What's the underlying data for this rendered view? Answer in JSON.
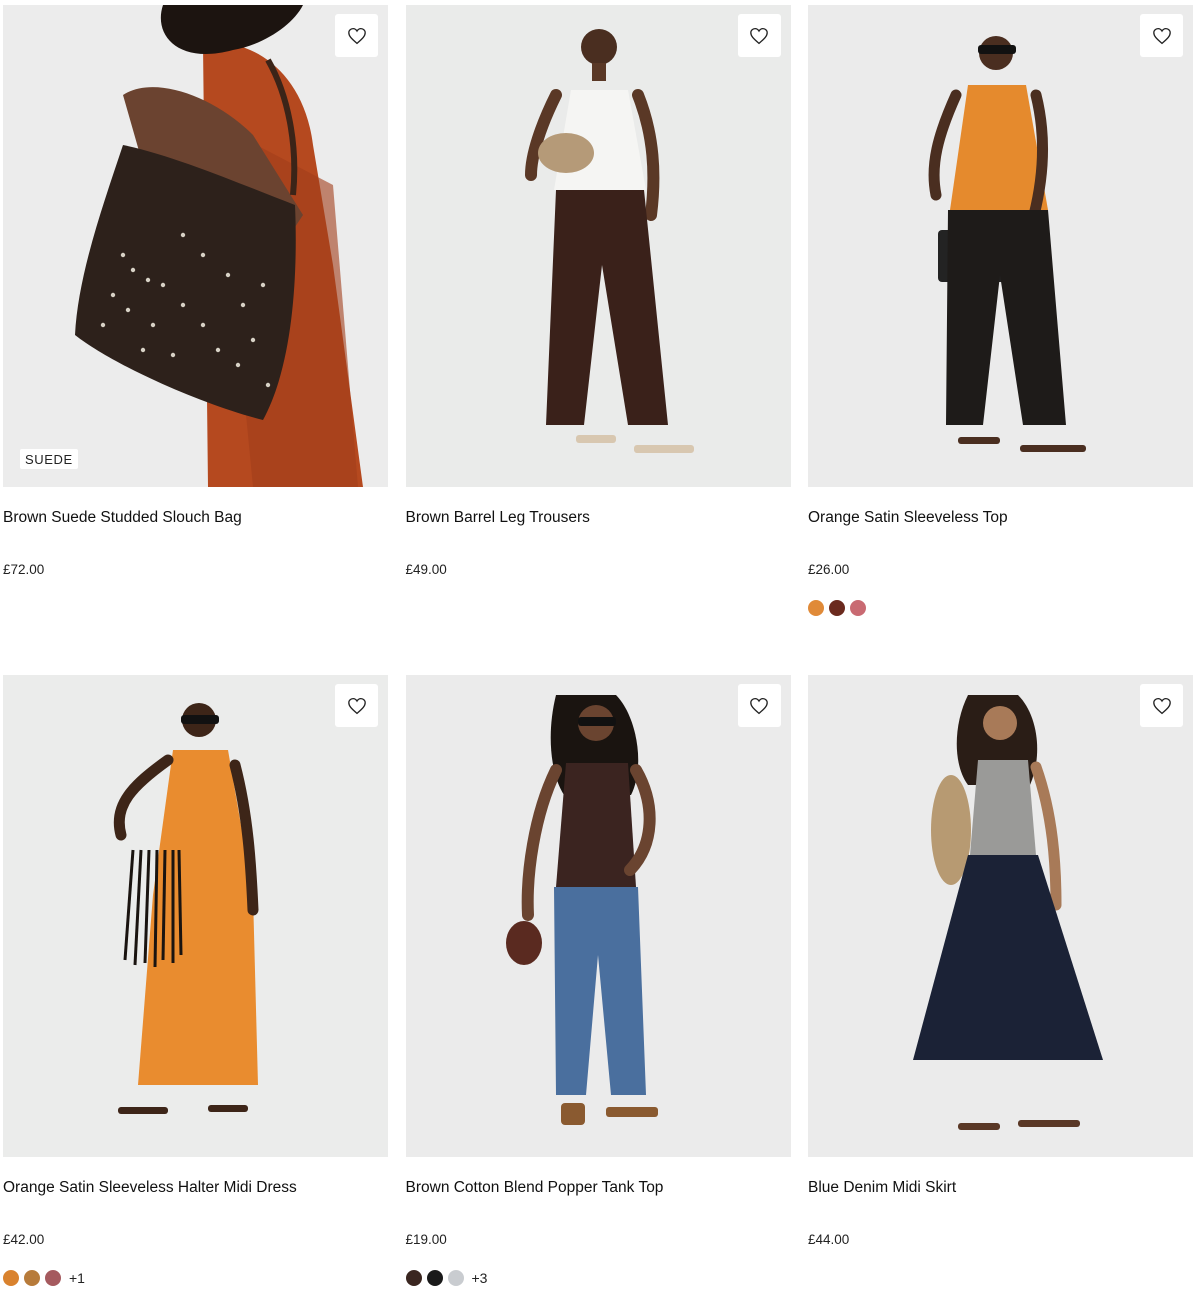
{
  "products": [
    {
      "name": "Brown Suede Studded Slouch Bag",
      "price": "£72.00",
      "badge": "SUEDE",
      "colors": []
    },
    {
      "name": "Brown Barrel Leg Trousers",
      "price": "£49.00",
      "colors": []
    },
    {
      "name": "Orange Satin Sleeveless Top",
      "price": "£26.00",
      "colors": [
        "#e08a38",
        "#6b2a1e",
        "#c96a72"
      ]
    },
    {
      "name": "Orange Satin Sleeveless Halter Midi Dress",
      "price": "£42.00",
      "colors": [
        "#d9822e",
        "#b77b3a",
        "#a55a5e"
      ],
      "more_colors": "+1"
    },
    {
      "name": "Brown Cotton Blend Popper Tank Top",
      "price": "£19.00",
      "colors": [
        "#3a2620",
        "#1a1a1a",
        "#c9ccd0"
      ],
      "more_colors": "+3"
    },
    {
      "name": "Blue Denim Midi Skirt",
      "price": "£44.00",
      "colors": []
    }
  ]
}
